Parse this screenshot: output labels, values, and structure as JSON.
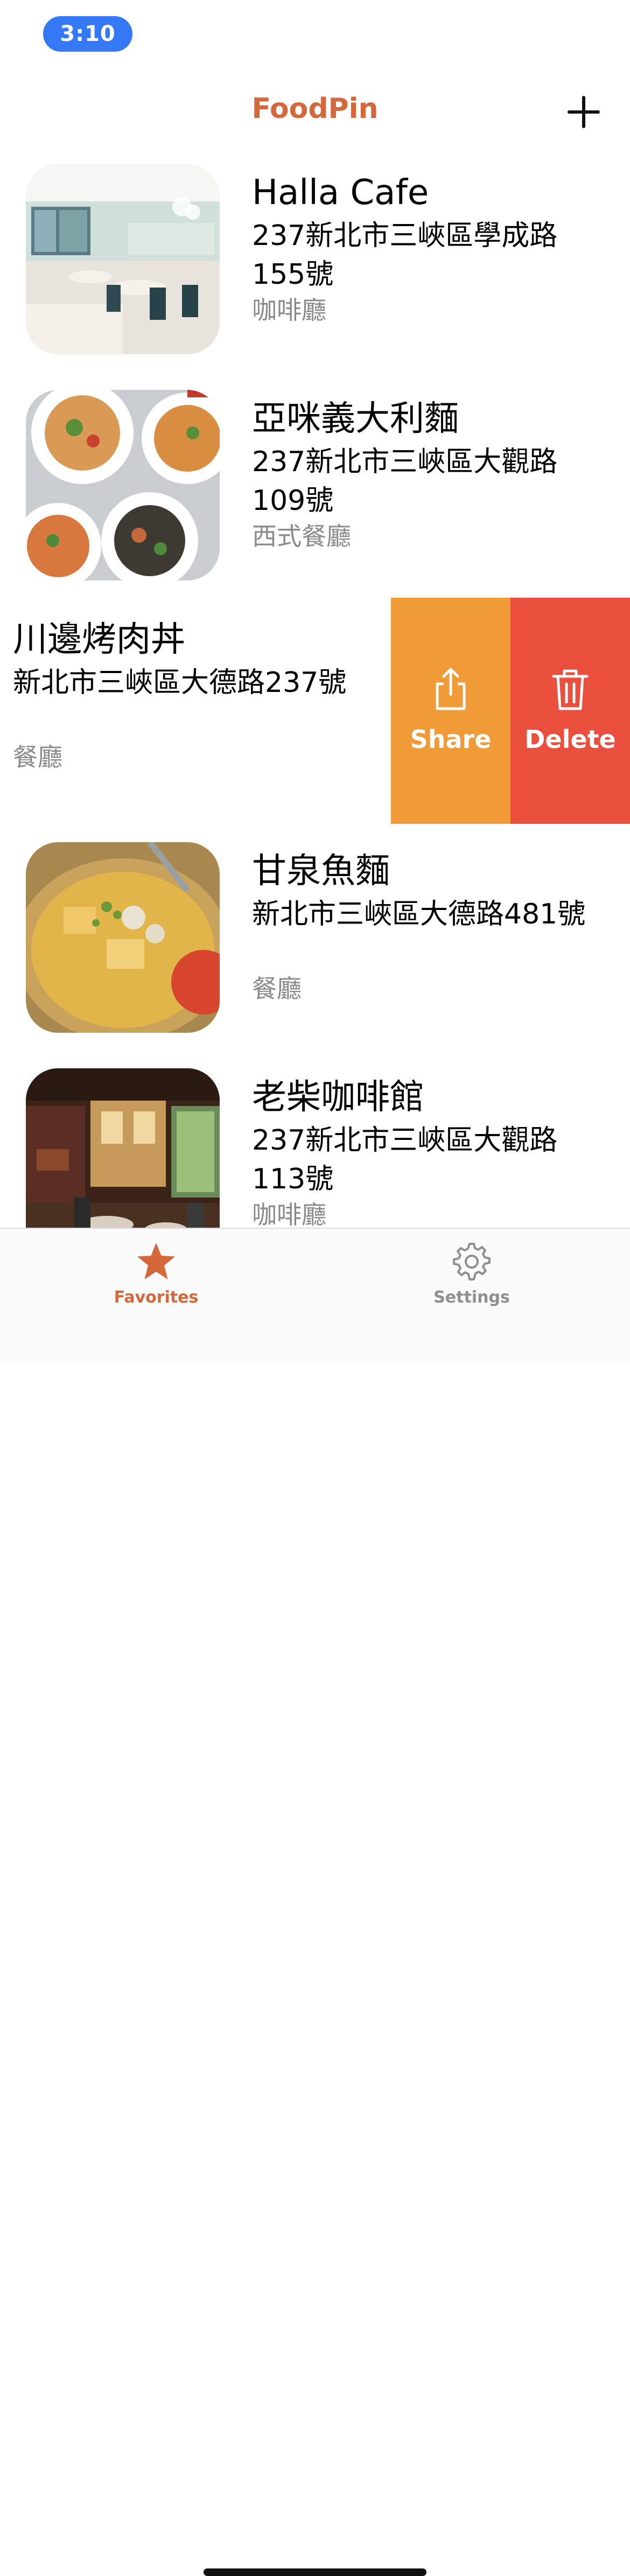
{
  "status_bar": {
    "time": "3:10"
  },
  "nav": {
    "title": "FoodPin",
    "add_icon": "plus-icon"
  },
  "restaurants": [
    {
      "name": "Halla Cafe",
      "address": "237新北市三峽區學成路155號",
      "type": "咖啡廳",
      "image": "cafe-interior"
    },
    {
      "name": "亞咪義大利麵",
      "address": "237新北市三峽區大觀路109號",
      "type": "西式餐廳",
      "image": "pasta-dishes"
    },
    {
      "name": "川邊烤肉丼",
      "address": "新北市三峽區大德路237號",
      "type": "餐廳",
      "image": "rice-bowl"
    },
    {
      "name": "甘泉魚麵",
      "address": "新北市三峽區大德路481號",
      "type": "餐廳",
      "image": "fish-noodle-soup"
    },
    {
      "name": "老柴咖啡館",
      "address": "237新北市三峽區大觀路113號",
      "type": "咖啡廳",
      "image": "restaurant-interior"
    }
  ],
  "swipe_actions": {
    "share": {
      "label": "Share",
      "color": "#f19a38",
      "icon": "share-icon"
    },
    "delete": {
      "label": "Delete",
      "color": "#ea4e3d",
      "icon": "trash-icon"
    }
  },
  "tab_bar": {
    "favorites": {
      "label": "Favorites",
      "icon": "star-icon",
      "selected": true,
      "color": "#d5683a"
    },
    "settings": {
      "label": "Settings",
      "icon": "gear-icon",
      "selected": false,
      "color": "#8e8e93"
    }
  },
  "colors": {
    "accent": "#d5683a",
    "status_pill": "#3478f6"
  }
}
